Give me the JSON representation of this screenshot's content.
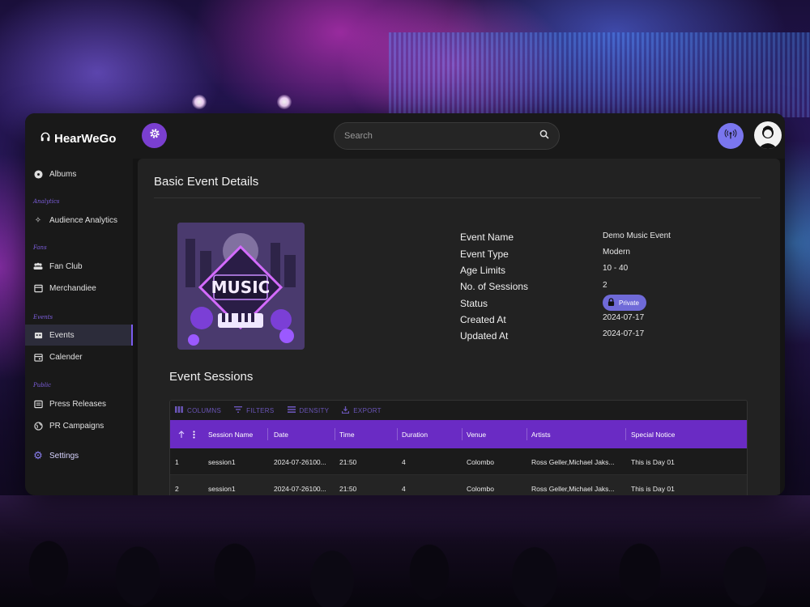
{
  "app": {
    "brand": "HearWeGo"
  },
  "sidebar": {
    "items": [
      {
        "label": "Albums",
        "icon": "disc-icon"
      },
      {
        "section": "Analytics"
      },
      {
        "label": "Audience Analytics",
        "icon": "sparkle-icon"
      },
      {
        "section": "Fans"
      },
      {
        "label": "Fan Club",
        "icon": "group-icon"
      },
      {
        "label": "Merchandiee",
        "icon": "store-icon"
      },
      {
        "section": "Events"
      },
      {
        "label": "Events",
        "icon": "events-icon",
        "active": true
      },
      {
        "label": "Calender",
        "icon": "calendar-icon"
      },
      {
        "section": "Public"
      },
      {
        "label": "Press Releases",
        "icon": "newspaper-icon"
      },
      {
        "label": "PR Campaigns",
        "icon": "globe-icon"
      }
    ],
    "settings": "Settings"
  },
  "topbar": {
    "search_placeholder": "Search"
  },
  "page": {
    "title": "Basic Event Details",
    "cover_text": "MUSIC"
  },
  "details": [
    {
      "label": "Event Name",
      "value": "Demo Music Event"
    },
    {
      "label": "Event Type",
      "value": "Modern"
    },
    {
      "label": "Age Limits",
      "value": "10 - 40"
    },
    {
      "label": "No. of Sessions",
      "value": "2"
    },
    {
      "label": "Status",
      "value": "Private"
    },
    {
      "label": "Created At",
      "value": "2024-07-17"
    },
    {
      "label": "Updated At",
      "value": "2024-07-17"
    }
  ],
  "sessions": {
    "title": "Event Sessions",
    "toolbar": [
      "COLUMNS",
      "FILTERS",
      "DENSITY",
      "EXPORT"
    ],
    "columns": [
      "Session Name",
      "Date",
      "Time",
      "Duration",
      "Venue",
      "Artists",
      "Special Notice"
    ],
    "rows": [
      [
        "1",
        "session1",
        "2024-07-26100...",
        "21:50",
        "4",
        "Colombo",
        "Ross Geller,Michael Jaks...",
        "This is Day 01"
      ],
      [
        "2",
        "session1",
        "2024-07-26100...",
        "21:50",
        "4",
        "Colombo",
        "Ross Geller,Michael Jaks...",
        "This is Day 01"
      ]
    ]
  },
  "colors": {
    "accent": "#6a2bc4",
    "pill": "#6f6ad8",
    "section_label": "#7e5fe0"
  }
}
